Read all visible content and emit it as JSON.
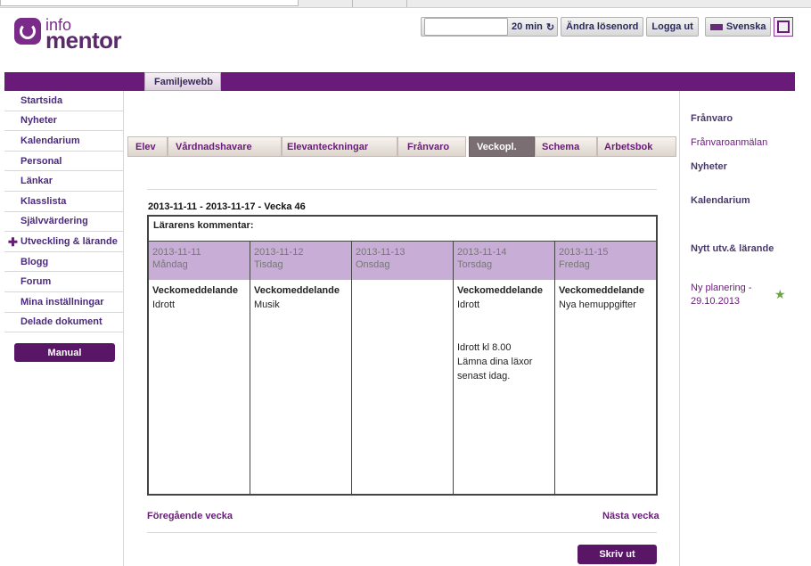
{
  "topbar": {
    "timer": "20 min",
    "change_password": "Ändra lösenord",
    "logout": "Logga ut",
    "language": "Svenska"
  },
  "logo": {
    "top": "info",
    "bottom": "mentor"
  },
  "main_tab": "Familjewebb",
  "sidebar": {
    "items": [
      {
        "label": "Startsida"
      },
      {
        "label": "Nyheter"
      },
      {
        "label": "Kalendarium"
      },
      {
        "label": "Personal"
      },
      {
        "label": "Länkar"
      },
      {
        "label": "Klasslista"
      },
      {
        "label": "Självvärdering"
      },
      {
        "label": "Utveckling & lärande"
      },
      {
        "label": "Blogg"
      },
      {
        "label": "Forum"
      },
      {
        "label": "Mina inställningar"
      },
      {
        "label": "Delade dokument"
      }
    ],
    "manual": "Manual"
  },
  "tabs": [
    "Elev",
    "Vårdnadshavare",
    "Elevanteckningar",
    "Frånvaro",
    "Veckopl.",
    "Schema",
    "Arbetsbok"
  ],
  "week": {
    "title": "2013-11-11 - 2013-11-17 - Vecka 46",
    "comment_label": "Lärarens kommentar:",
    "days": [
      {
        "date": "2013-11-11",
        "name": "Måndag",
        "heading": "Veckomeddelande",
        "lines": [
          "Idrott"
        ],
        "extra": []
      },
      {
        "date": "2013-11-12",
        "name": "Tisdag",
        "heading": "Veckomeddelande",
        "lines": [
          "Musik"
        ],
        "extra": []
      },
      {
        "date": "2013-11-13",
        "name": "Onsdag",
        "heading": "",
        "lines": [],
        "extra": []
      },
      {
        "date": "2013-11-14",
        "name": "Torsdag",
        "heading": "Veckomeddelande",
        "lines": [
          "Idrott"
        ],
        "extra": [
          "Idrott kl 8.00",
          "Lämna dina läxor",
          "senast idag."
        ]
      },
      {
        "date": "2013-11-15",
        "name": "Fredag",
        "heading": "Veckomeddelande",
        "lines": [
          "Nya hemuppgifter"
        ],
        "extra": []
      }
    ]
  },
  "nav": {
    "prev": "Föregående vecka",
    "next": "Nästa vecka"
  },
  "print": "Skriv ut",
  "right": {
    "franvaro": "Frånvaro",
    "franvaroanmalan": "Frånvaroanmälan",
    "nyheter": "Nyheter",
    "kalendarium": "Kalendarium",
    "nytt": "Nytt utv.& lärande",
    "planering1": "Ny planering -",
    "planering2": "29.10.2013"
  }
}
